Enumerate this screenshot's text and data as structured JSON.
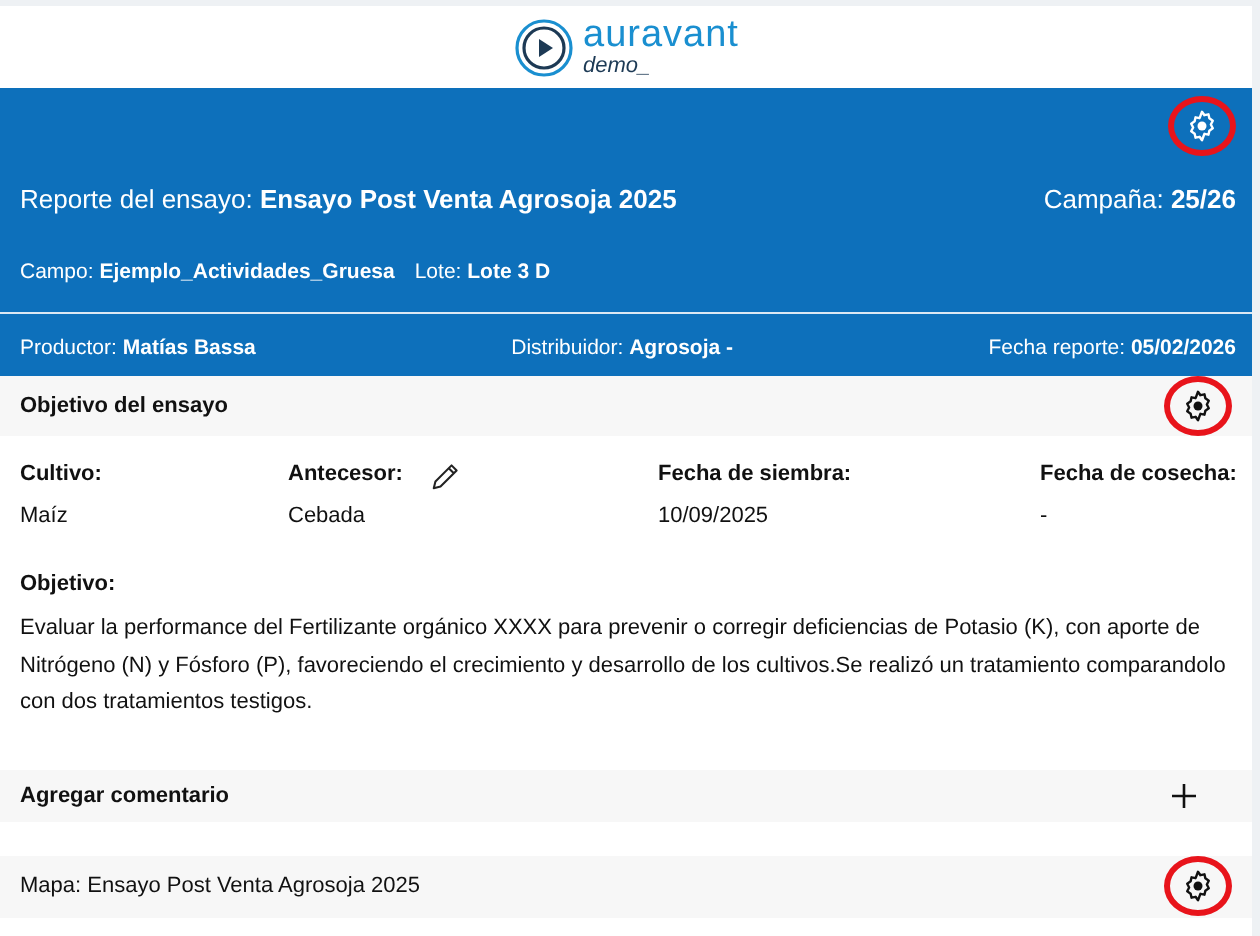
{
  "logo": {
    "name": "auravant",
    "tagline": "demo_"
  },
  "header": {
    "settings_highlighted": true,
    "title_label": "Reporte del ensayo:",
    "title_value": "Ensayo Post Venta Agrosoja 2025",
    "campaign_label": "Campaña:",
    "campaign_value": "25/26",
    "location": [
      {
        "label": "Campo:",
        "value": "Ejemplo_Actividades_Gruesa"
      },
      {
        "label": "Lote:",
        "value": "Lote 3 D"
      }
    ],
    "details": [
      {
        "label": "Productor:",
        "value": "Matías Bassa"
      },
      {
        "label": "Distribuidor:",
        "value": "Agrosoja -"
      },
      {
        "label": "Fecha reporte:",
        "value": "05/02/2026"
      }
    ]
  },
  "objective_section": {
    "title": "Objetivo del ensayo",
    "settings_highlighted": true,
    "fields": [
      {
        "label": "Cultivo:",
        "value": "Maíz",
        "editable": false
      },
      {
        "label": "Antecesor:",
        "value": "Cebada",
        "editable": true
      },
      {
        "label": "Fecha de siembra:",
        "value": "10/09/2025",
        "editable": false
      },
      {
        "label": "Fecha de cosecha:",
        "value": "-",
        "editable": false
      }
    ],
    "objective_label": "Objetivo:",
    "objective_text": "Evaluar la performance del Fertilizante orgánico XXXX para prevenir o corregir deficiencias de Potasio (K), con aporte de Nitrógeno (N) y Fósforo (P), favoreciendo el crecimiento y desarrollo de los cultivos.Se realizó un tratamiento comparandolo con dos tratamientos testigos."
  },
  "comment_section": {
    "title": "Agregar comentario"
  },
  "map_section": {
    "title": "Mapa: Ensayo Post Venta Agrosoja 2025",
    "settings_highlighted": true
  }
}
